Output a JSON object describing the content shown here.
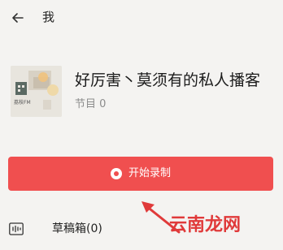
{
  "header": {
    "back_icon": "arrow-left-icon",
    "title": "我"
  },
  "podcast": {
    "cover_text": "荔枝FM",
    "name": "好厉害丶莫须有的私人播客",
    "episode_count": "节目 0"
  },
  "record_button": {
    "icon": "record-icon",
    "label": "开始录制",
    "color": "#f04f4f"
  },
  "drafts": {
    "icon": "audio-wave-icon",
    "label": "草稿箱(0)"
  },
  "annotation": {
    "arrow_color": "#e03a3a"
  },
  "watermark": {
    "text": "云南龙网"
  }
}
